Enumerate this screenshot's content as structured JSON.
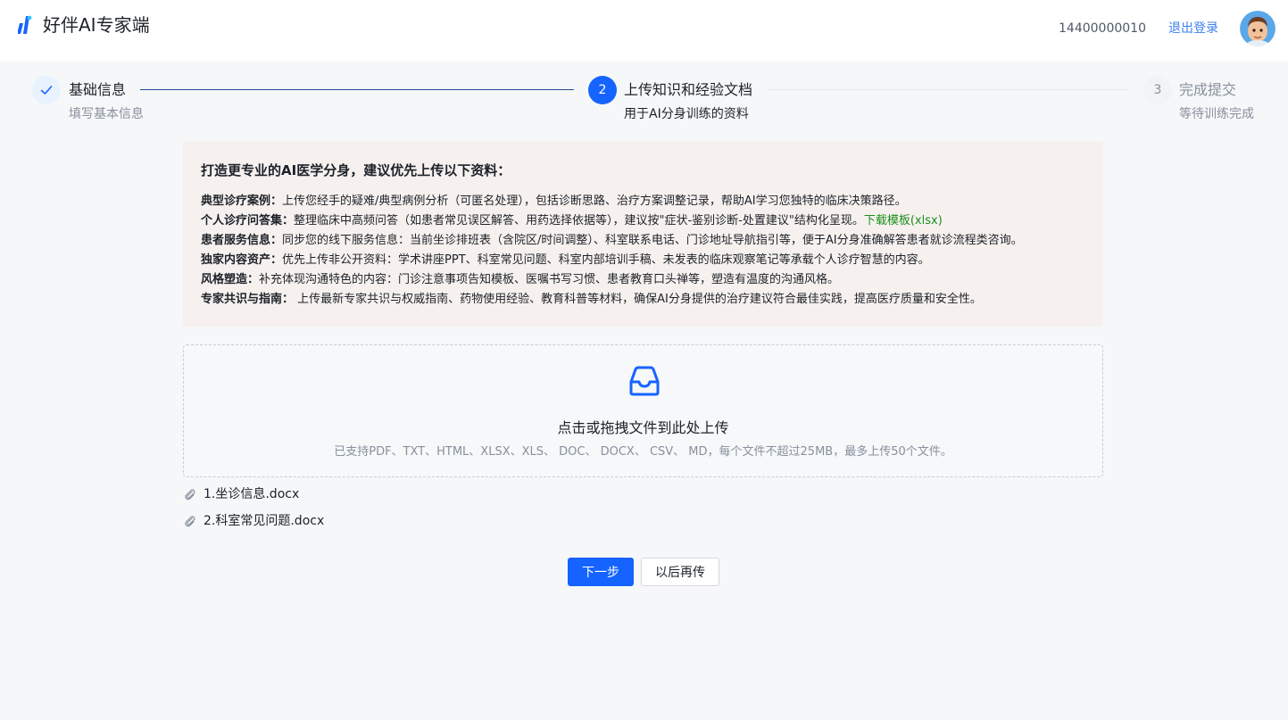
{
  "header": {
    "app_title": "好伴AI专家端",
    "phone": "14400000010",
    "logout_label": "退出登录"
  },
  "steps": [
    {
      "number": "1",
      "title": "基础信息",
      "desc": "填写基本信息",
      "status": "finished"
    },
    {
      "number": "2",
      "title": "上传知识和经验文档",
      "desc": "用于AI分身训练的资料",
      "status": "current"
    },
    {
      "number": "3",
      "title": "完成提交",
      "desc": "等待训练完成",
      "status": "waiting"
    }
  ],
  "info": {
    "heading": "打造更专业的AI医学分身，建议优先上传以下资料：",
    "rows": [
      {
        "label": "典型诊疗案例：",
        "text": "上传您经手的疑难/典型病例分析（可匿名处理），包括诊断思路、治疗方案调整记录，帮助AI学习您独特的临床决策路径。"
      },
      {
        "label": "个人诊疗问答集：",
        "text": "整理临床中高频问答（如患者常见误区解答、用药选择依据等），建议按\"症状-鉴别诊断-处置建议\"结构化呈现。",
        "link": "下载模板(xlsx)"
      },
      {
        "label": "患者服务信息：",
        "text": "同步您的线下服务信息：当前坐诊排班表（含院区/时间调整）、科室联系电话、门诊地址导航指引等，便于AI分身准确解答患者就诊流程类咨询。"
      },
      {
        "label": "独家内容资产：",
        "text": "优先上传非公开资料：学术讲座PPT、科室常见问题、科室内部培训手稿、未发表的临床观察笔记等承载个人诊疗智慧的内容。"
      },
      {
        "label": "风格塑造：",
        "text": "补充体现沟通特色的内容：门诊注意事项告知模板、医嘱书写习惯、患者教育口头禅等，塑造有温度的沟通风格。"
      },
      {
        "label": "专家共识与指南：",
        "text": " 上传最新专家共识与权威指南、药物使用经验、教育科普等材料，确保AI分身提供的治疗建议符合最佳实践，提高医疗质量和安全性。"
      }
    ]
  },
  "upload": {
    "title": "点击或拖拽文件到此处上传",
    "hint": "已支持PDF、TXT、HTML、XLSX、XLS、 DOC、 DOCX、 CSV、 MD，每个文件不超过25MB，最多上传50个文件。"
  },
  "files": [
    {
      "name": "1.坐诊信息.docx"
    },
    {
      "name": "2.科室常见问题.docx"
    }
  ],
  "buttons": {
    "next_label": "下一步",
    "later_label": "以后再传"
  },
  "icons": {
    "logo": "logo-icon",
    "avatar": "avatar-memoji",
    "step1": "check-icon",
    "upload": "inbox-icon",
    "file": "paperclip-icon"
  },
  "colors": {
    "primary": "#1664ff",
    "link": "#3f7ef0",
    "download_link": "#1a8f1a",
    "info_panel_bg": "#f6f1ee",
    "page_bg": "#f6f7f9"
  }
}
